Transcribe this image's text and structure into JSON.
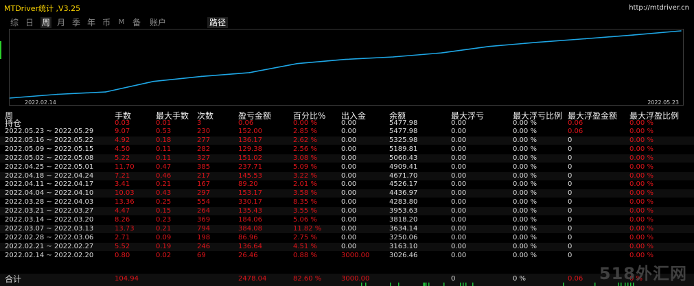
{
  "app": {
    "title": "MTDriver统计 ,V3.25",
    "url": "http://mtdriver.cn",
    "watermark": "518外汇网"
  },
  "tabs": [
    {
      "label": "综",
      "active": false
    },
    {
      "label": "日",
      "active": false
    },
    {
      "label": "周",
      "active": true
    },
    {
      "label": "月",
      "active": false
    },
    {
      "label": "季",
      "active": false
    },
    {
      "label": "年",
      "active": false
    },
    {
      "label": "币",
      "active": false
    },
    {
      "label": "M",
      "active": false
    },
    {
      "label": "备",
      "active": false
    },
    {
      "label": "账户",
      "active": false
    },
    {
      "label": "路径",
      "active": true
    }
  ],
  "chart_data": {
    "type": "line",
    "series_color": "#1ea7e6",
    "x_start_label": "2022.02.14",
    "x_end_label": "2022.05.23",
    "x": [
      "2022.02.14",
      "2022.02.21",
      "2022.02.28",
      "2022.03.07",
      "2022.03.14",
      "2022.03.21",
      "2022.03.28",
      "2022.04.04",
      "2022.04.11",
      "2022.04.18",
      "2022.04.25",
      "2022.05.02",
      "2022.05.09",
      "2022.05.16",
      "2022.05.23"
    ],
    "values": [
      3026.46,
      3163.1,
      3250.06,
      3634.14,
      3818.2,
      3953.63,
      4283.8,
      4436.97,
      4526.17,
      4671.7,
      4909.41,
      5060.43,
      5189.81,
      5325.98,
      5477.98
    ]
  },
  "columns": [
    "周",
    "手数",
    "最大手数",
    "次数",
    "盈亏金额",
    "百分比%",
    "出入金",
    "余额",
    "最大浮亏",
    "最大浮亏比例",
    "最大浮盈金额",
    "最大浮盈比例"
  ],
  "holding": {
    "label": "持仓",
    "values": [
      "0.03",
      "0.01",
      "3",
      "0.06",
      "0.00 %",
      "0.00",
      "5477.98",
      "0.00",
      "0.00 %",
      "0.06",
      "0.00 %"
    ]
  },
  "rows": [
    [
      "2022.05.23 ~ 2022.05.29",
      "9.07",
      "0.53",
      "230",
      "152.00",
      "2.85 %",
      "0.00",
      "5477.98",
      "0.00",
      "0.00 %",
      "0.06",
      "0.00 %"
    ],
    [
      "2022.05.16 ~ 2022.05.22",
      "4.92",
      "0.18",
      "277",
      "136.17",
      "2.62 %",
      "0.00",
      "5325.98",
      "0.00",
      "0.00 %",
      "0",
      "0.00 %"
    ],
    [
      "2022.05.09 ~ 2022.05.15",
      "4.50",
      "0.11",
      "282",
      "129.38",
      "2.56 %",
      "0.00",
      "5189.81",
      "0.00",
      "0.00 %",
      "0",
      "0.00 %"
    ],
    [
      "2022.05.02 ~ 2022.05.08",
      "5.22",
      "0.11",
      "327",
      "151.02",
      "3.08 %",
      "0.00",
      "5060.43",
      "0.00",
      "0.00 %",
      "0",
      "0.00 %"
    ],
    [
      "2022.04.25 ~ 2022.05.01",
      "11.70",
      "0.47",
      "385",
      "237.71",
      "5.09 %",
      "0.00",
      "4909.41",
      "0.00",
      "0.00 %",
      "0",
      "0.00 %"
    ],
    [
      "2022.04.18 ~ 2022.04.24",
      "7.21",
      "0.46",
      "217",
      "145.53",
      "3.22 %",
      "0.00",
      "4671.70",
      "0.00",
      "0.00 %",
      "0",
      "0.00 %"
    ],
    [
      "2022.04.11 ~ 2022.04.17",
      "3.41",
      "0.21",
      "167",
      "89.20",
      "2.01 %",
      "0.00",
      "4526.17",
      "0.00",
      "0.00 %",
      "0",
      "0.00 %"
    ],
    [
      "2022.04.04 ~ 2022.04.10",
      "10.03",
      "0.43",
      "297",
      "153.17",
      "3.58 %",
      "0.00",
      "4436.97",
      "0.00",
      "0.00 %",
      "0",
      "0.00 %"
    ],
    [
      "2022.03.28 ~ 2022.04.03",
      "13.36",
      "0.25",
      "554",
      "330.17",
      "8.35 %",
      "0.00",
      "4283.80",
      "0.00",
      "0.00 %",
      "0",
      "0.00 %"
    ],
    [
      "2022.03.21 ~ 2022.03.27",
      "4.47",
      "0.15",
      "264",
      "135.43",
      "3.55 %",
      "0.00",
      "3953.63",
      "0.00",
      "0.00 %",
      "0",
      "0.00 %"
    ],
    [
      "2022.03.14 ~ 2022.03.20",
      "8.26",
      "0.23",
      "369",
      "184.06",
      "5.06 %",
      "0.00",
      "3818.20",
      "0.00",
      "0.00 %",
      "0",
      "0.00 %"
    ],
    [
      "2022.03.07 ~ 2022.03.13",
      "13.73",
      "0.21",
      "794",
      "384.08",
      "11.82 %",
      "0.00",
      "3634.14",
      "0.00",
      "0.00 %",
      "0",
      "0.00 %"
    ],
    [
      "2022.02.28 ~ 2022.03.06",
      "2.71",
      "0.09",
      "198",
      "86.96",
      "2.75 %",
      "0.00",
      "3250.06",
      "0.00",
      "0.00 %",
      "0",
      "0.00 %"
    ],
    [
      "2022.02.21 ~ 2022.02.27",
      "5.52",
      "0.19",
      "246",
      "136.64",
      "4.51 %",
      "0.00",
      "3163.10",
      "0.00",
      "0.00 %",
      "0",
      "0.00 %"
    ],
    [
      "2022.02.14 ~ 2022.02.20",
      "0.80",
      "0.02",
      "69",
      "26.46",
      "0.88 %",
      "3000.00",
      "3026.46",
      "0.00",
      "0.00 %",
      "0",
      "0.00 %"
    ]
  ],
  "total": {
    "label": "合计",
    "values": [
      "104.94",
      "",
      "",
      "2478.04",
      "82.60 %",
      "3000.00",
      "",
      "0",
      "0 %",
      "0.06",
      "0 %"
    ]
  }
}
